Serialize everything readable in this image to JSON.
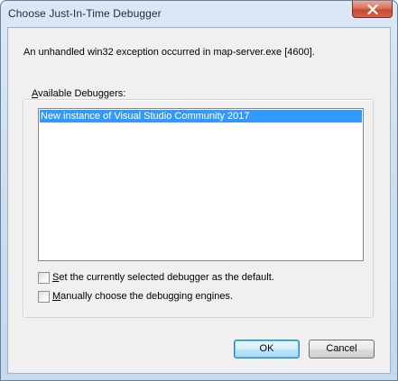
{
  "window": {
    "title": "Choose Just-In-Time Debugger"
  },
  "dialog": {
    "message": "An unhandled win32 exception occurred in map-server.exe [4600].",
    "group": {
      "label_accel": "A",
      "label_rest": "vailable Debuggers:"
    },
    "debuggers": [
      "New instance of Visual Studio Community 2017"
    ],
    "selected_index": 0,
    "options": {
      "set_default": {
        "accel": "S",
        "rest": "et the currently selected debugger as the default.",
        "checked": false
      },
      "manual": {
        "accel": "M",
        "rest": "anually choose the debugging engines.",
        "checked": false
      }
    },
    "buttons": {
      "ok": "OK",
      "cancel": "Cancel"
    }
  },
  "icons": {
    "close": "close-icon"
  },
  "colors": {
    "selection": "#3399ff",
    "close_button": "#c74a33"
  }
}
